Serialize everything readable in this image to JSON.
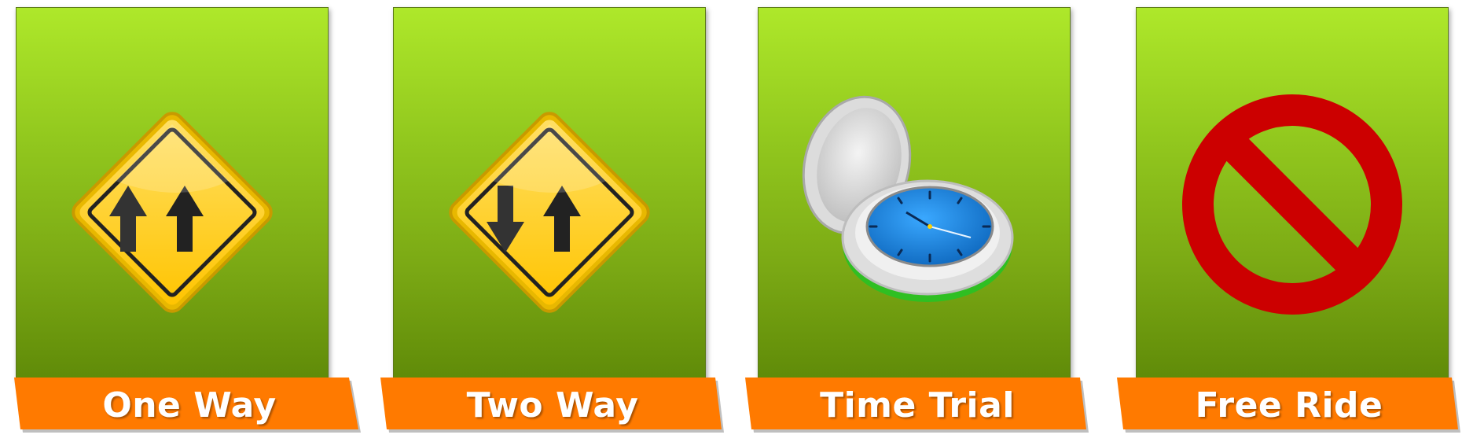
{
  "modes": [
    {
      "id": "one-way",
      "label": "One Way",
      "icon": "one-way-road-sign-icon"
    },
    {
      "id": "two-way",
      "label": "Two Way",
      "icon": "two-way-road-sign-icon"
    },
    {
      "id": "time-trial",
      "label": "Time Trial",
      "icon": "pocket-watch-icon"
    },
    {
      "id": "free-ride",
      "label": "Free Ride",
      "icon": "no-entry-sign-icon"
    }
  ],
  "colors": {
    "panel_top": "#aee82a",
    "panel_bottom": "#5f8a08",
    "banner": "#ff7a00",
    "sign_yellow": "#ffcc00",
    "arrow": "#222222",
    "prohibit_red": "#cc0000",
    "watch_face": "#1e8de0"
  }
}
